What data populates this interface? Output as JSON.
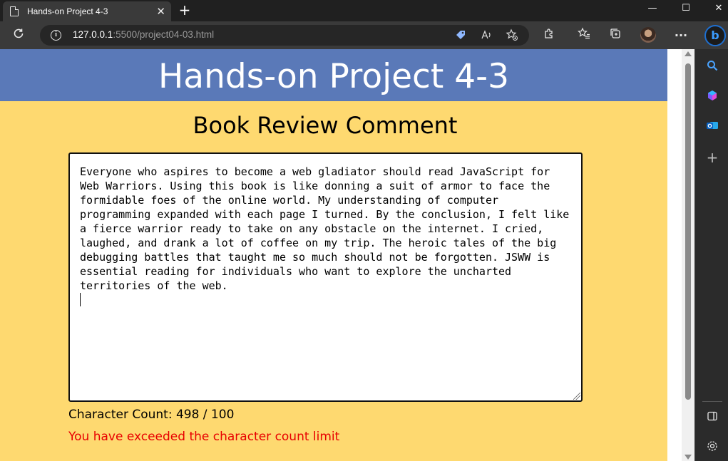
{
  "browser": {
    "tab_title": "Hands-on Project 4-3",
    "tab_close": "✕",
    "new_tab": "+",
    "window_controls": {
      "minimize": "—",
      "maximize": "☐",
      "close": "✕"
    },
    "url_host": "127.0.0.1",
    "url_rest": ":5500/project04-03.html",
    "icons": [
      "page-icon",
      "refresh-icon",
      "info-icon",
      "tag-icon",
      "read-aloud-icon",
      "favorite-add-icon",
      "extensions-icon",
      "favorites-icon",
      "collections-icon",
      "avatar",
      "more-icon",
      "bing-icon"
    ]
  },
  "page": {
    "header": "Hands-on Project 4-3",
    "subtitle": "Book Review Comment",
    "comment": "Everyone who aspires to become a web gladiator should read JavaScript for Web Warriors. Using this book is like donning a suit of armor to face the formidable foes of the online world. My understanding of computer programming expanded with each page I turned. By the conclusion, I felt like a fierce warrior ready to take on any obstacle on the internet. I cried, laughed, and drank a lot of coffee on my trip. The heroic tales of the big debugging battles that taught me so much should not be forgotten. JSWW is essential reading for individuals who want to explore the uncharted territories of the web.\n",
    "count_text": "Character Count: 498 / 100",
    "warning_text": "You have exceeded the character count limit"
  },
  "sidebar": {
    "icons": [
      "search-icon",
      "copilot-icon",
      "outlook-icon",
      "add-icon",
      "sidebar-toggle-icon",
      "settings-icon"
    ]
  },
  "colors": {
    "header_bg": "#5a79b8",
    "page_bg": "#fed970",
    "warning": "#e80000"
  }
}
